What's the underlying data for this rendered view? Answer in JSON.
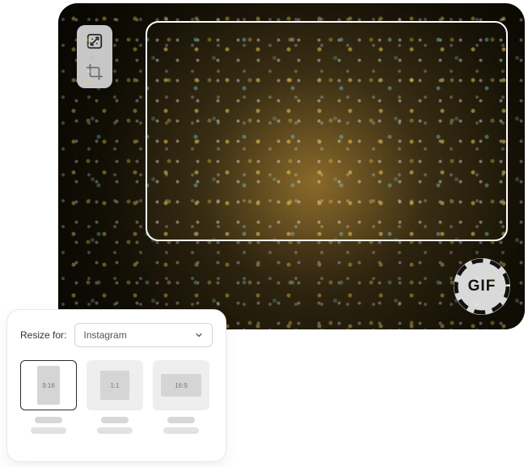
{
  "toolbar": {
    "resize_icon": "resize-icon",
    "crop_icon": "crop-icon"
  },
  "badge": {
    "label": "GIF"
  },
  "panel": {
    "label": "Resize for:",
    "selected_platform": "Instagram",
    "ratios": [
      {
        "label": "9:16",
        "shape": "portrait",
        "selected": true
      },
      {
        "label": "1:1",
        "shape": "square",
        "selected": false
      },
      {
        "label": "16:9",
        "shape": "wide",
        "selected": false
      }
    ]
  }
}
